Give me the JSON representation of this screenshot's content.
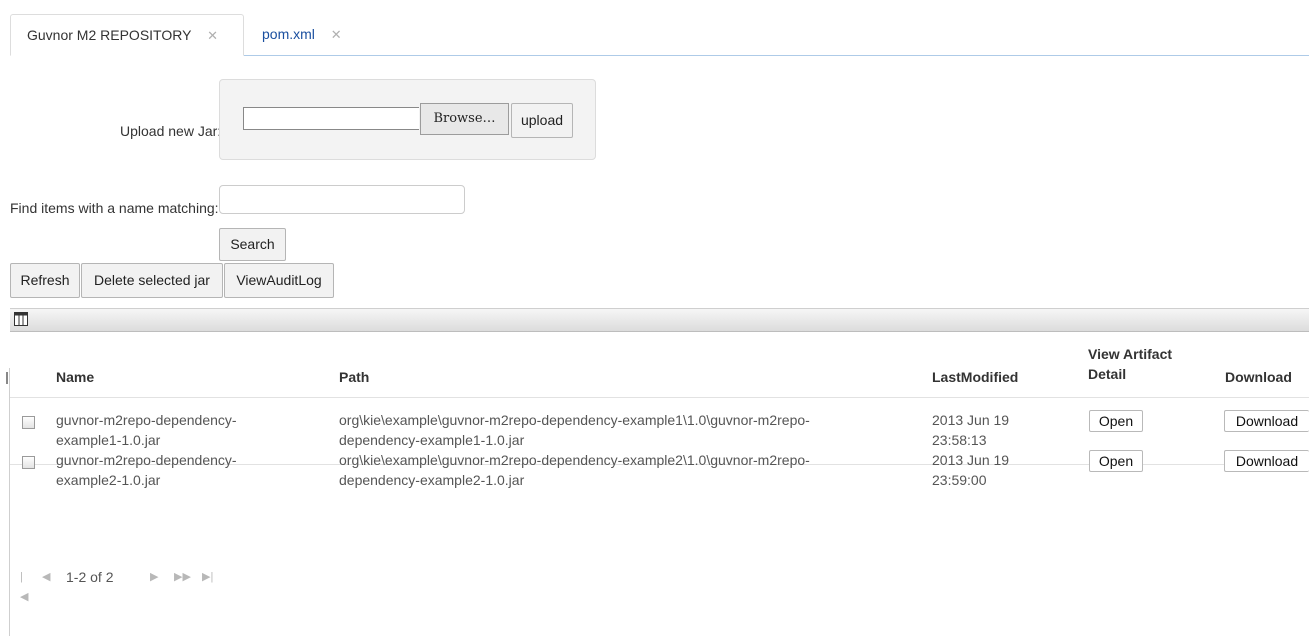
{
  "tabs": [
    {
      "label": "Guvnor M2 REPOSITORY",
      "close": "✕"
    },
    {
      "label": "pom.xml",
      "close": "✕"
    }
  ],
  "upload": {
    "label": "Upload new Jar:",
    "browse_label": "Browse…",
    "upload_label": "upload",
    "file_value": ""
  },
  "search": {
    "label": "Find items with a name matching:",
    "value": "",
    "button_label": "Search"
  },
  "toolbar": {
    "refresh": "Refresh",
    "delete": "Delete selected jar",
    "audit": "ViewAuditLog"
  },
  "table": {
    "headers": {
      "name": "Name",
      "path": "Path",
      "modified": "LastModified",
      "view_detail_1": "View Artifact",
      "view_detail_2": "Detail",
      "download": "Download"
    },
    "rows": [
      {
        "name_1": "guvnor-m2repo-dependency-",
        "name_2": "example1-1.0.jar",
        "path_1": "org\\kie\\example\\guvnor-m2repo-dependency-example1\\1.0\\guvnor-m2repo-",
        "path_2": "dependency-example1-1.0.jar",
        "date_1": "2013 Jun 19",
        "date_2": "23:58:13",
        "open": "Open",
        "download": "Download"
      },
      {
        "name_1": "guvnor-m2repo-dependency-",
        "name_2": "example2-1.0.jar",
        "path_1": "org\\kie\\example\\guvnor-m2repo-dependency-example2\\1.0\\guvnor-m2repo-",
        "path_2": "dependency-example2-1.0.jar",
        "date_1": "2013 Jun 19",
        "date_2": "23:59:00",
        "open": "Open",
        "download": "Download"
      }
    ]
  },
  "pager": {
    "range": "1-2 of 2",
    "icons": [
      "first-page-icon",
      "prev-page-icon",
      "next-page-icon",
      "fast-forward-icon",
      "last-page-icon"
    ]
  },
  "colors": {
    "tab_link": "#1a4f9f",
    "tab_underline": "#aecbe8",
    "panel_bg": "#f3f3f3"
  }
}
